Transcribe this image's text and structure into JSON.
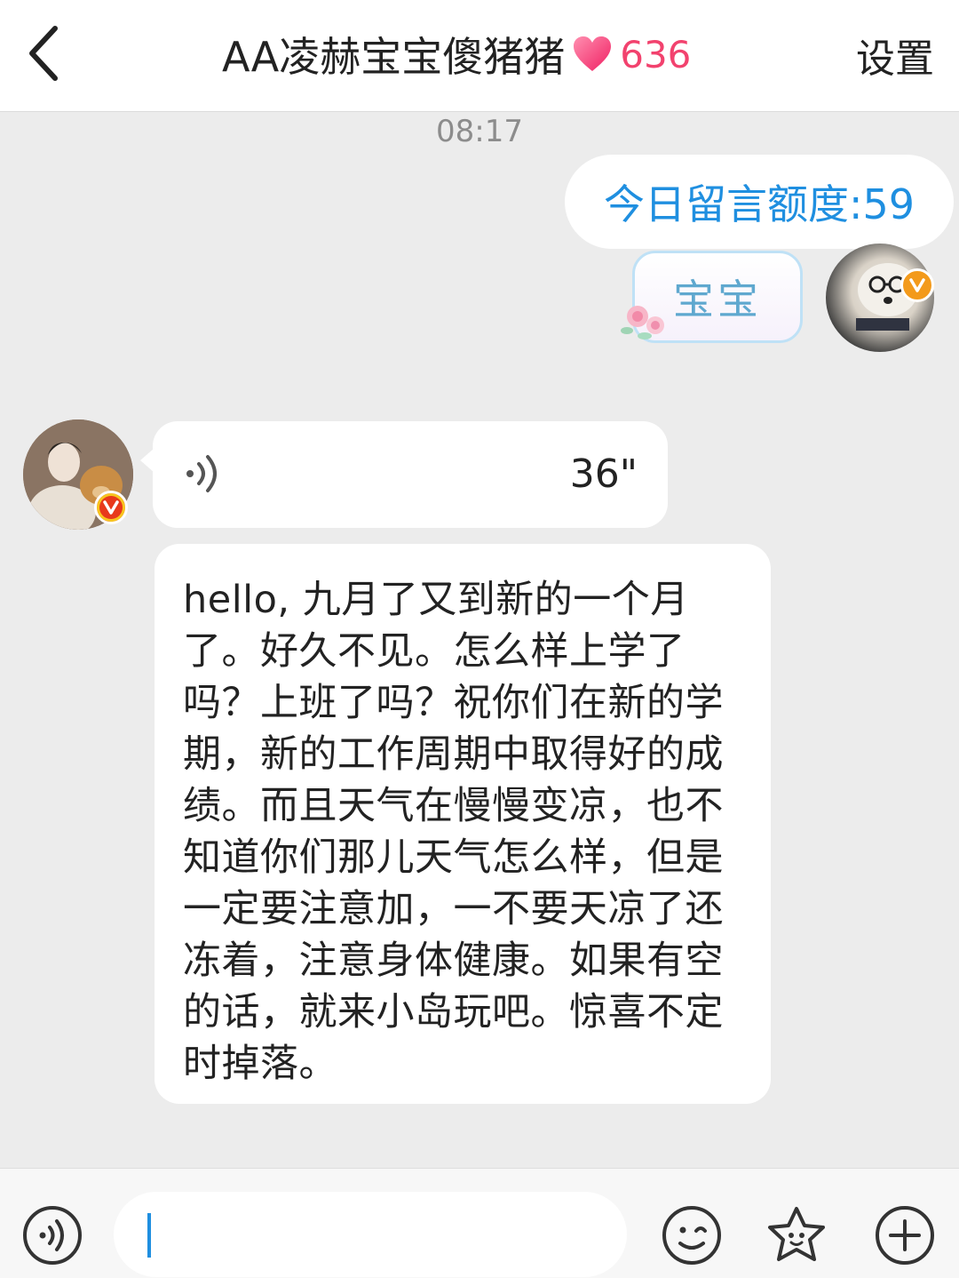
{
  "header": {
    "back_icon": "chevron-left-icon",
    "title": "AA凌赫宝宝傻猪猪",
    "intimacy_icon": "heart-icon",
    "intimacy_value": "636",
    "settings_label": "设置",
    "colors": {
      "intimacy": "#f2426e"
    }
  },
  "chat": {
    "timestamp": "08:17",
    "messages": [
      {
        "side": "right",
        "type": "text",
        "text": "今日留言额度:59"
      },
      {
        "side": "right",
        "type": "sticker",
        "text": "宝宝",
        "decoration": "flower-icon",
        "avatar": "avatar-dog-with-glasses",
        "badge": "vip-badge"
      },
      {
        "side": "left",
        "type": "voice",
        "duration": "36\"",
        "avatar": "avatar-person-with-golden-retriever",
        "badge": "vip-badge"
      },
      {
        "side": "left",
        "type": "text",
        "text": "hello, 九月了又到新的一个月了。好久不见。怎么样上学了吗？上班了吗？祝你们在新的学期，新的工作周期中取得好的成绩。而且天气在慢慢变凉，也不知道你们那儿天气怎么样，但是一定要注意加，一不要天凉了还冻着，注意身体健康。如果有空的话，就来小岛玩吧。惊喜不定时掉落。"
      }
    ]
  },
  "input_bar": {
    "voice_icon": "voice-input-icon",
    "text_value": "",
    "emoji_icon": "emoji-icon",
    "sticker_icon": "sticker-icon",
    "plus_icon": "plus-icon",
    "colors": {
      "caret": "#1f8fe0"
    }
  }
}
